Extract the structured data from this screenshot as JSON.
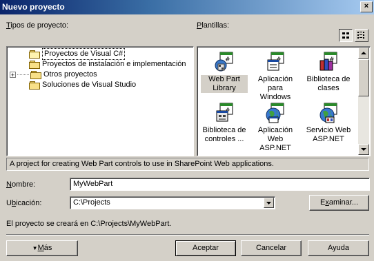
{
  "window": {
    "title": "Nuevo proyecto",
    "close_glyph": "×"
  },
  "labels": {
    "project_types_pre": "",
    "project_types_u": "T",
    "project_types_post": "ipos de proyecto:",
    "templates_pre": "",
    "templates_u": "P",
    "templates_post": "lantillas:"
  },
  "project_types": [
    {
      "label": "Proyectos de Visual C#",
      "selected": true
    },
    {
      "label": "Proyectos de instalación e implementación"
    },
    {
      "label": "Otros proyectos",
      "expander": "+"
    },
    {
      "label": "Soluciones de Visual Studio"
    }
  ],
  "templates": [
    {
      "line1": "Web Part",
      "line2": "Library",
      "icon": "webpart-library-icon",
      "selected": true
    },
    {
      "line1": "Aplicación",
      "line2": "para Windows",
      "icon": "windows-app-icon"
    },
    {
      "line1": "Biblioteca de",
      "line2": "clases",
      "icon": "class-library-icon"
    },
    {
      "line1": "Biblioteca de",
      "line2": "controles ...",
      "icon": "control-library-icon"
    },
    {
      "line1": "Aplicación",
      "line2": "Web ASP.NET",
      "icon": "aspnet-web-app-icon"
    },
    {
      "line1": "Servicio Web",
      "line2": "ASP.NET",
      "icon": "aspnet-web-service-icon"
    }
  ],
  "description": "A project for creating Web Part controls to use in SharePoint Web applications.",
  "name_field": {
    "label_u": "N",
    "label_post": "ombre:",
    "value": "MyWebPart"
  },
  "location_field": {
    "label_pre": "U",
    "label_u": "b",
    "label_post": "icación:",
    "value": "C:\\Projects"
  },
  "browse_button": {
    "pre": "E",
    "u": "x",
    "post": "aminar..."
  },
  "info_text": "El proyecto se creará en C:\\Projects\\MyWebPart.",
  "buttons": {
    "more_arrow": "▼",
    "more_u": "M",
    "more_post": "ás",
    "accept": "Aceptar",
    "cancel": "Cancelar",
    "help": "Ayuda"
  },
  "colors": {
    "title_start": "#0a246a",
    "title_end": "#a6caf0",
    "face": "#d4d0c8"
  }
}
